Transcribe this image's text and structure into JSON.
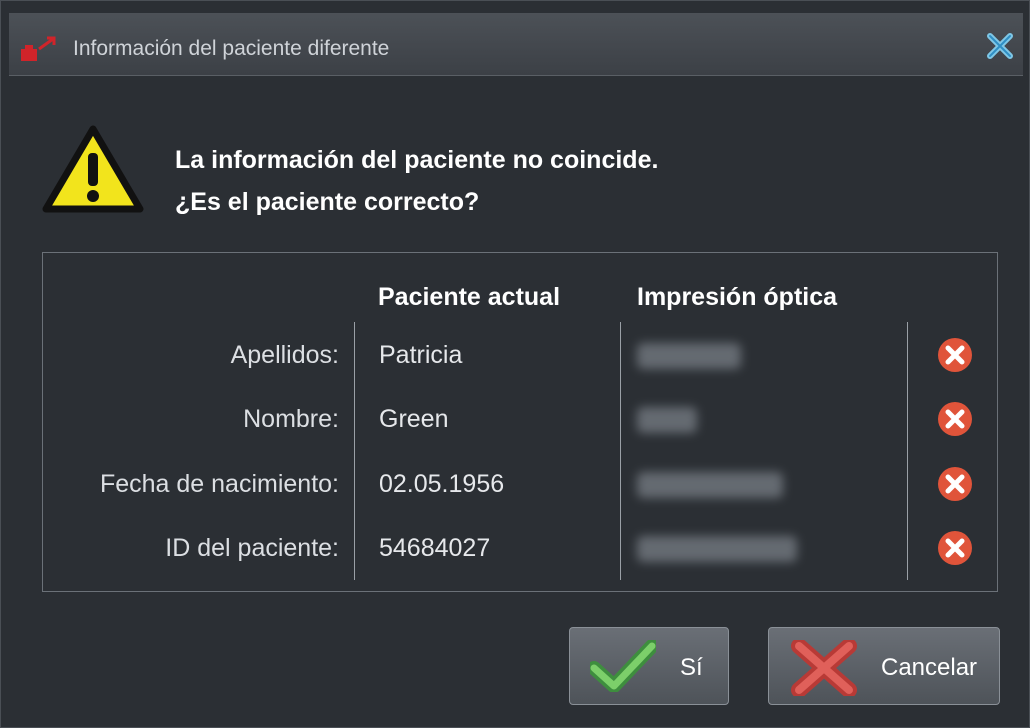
{
  "window": {
    "title": "Información del paciente diferente"
  },
  "message": {
    "line1": "La información del paciente no coincide.",
    "line2": "¿Es el paciente correcto?"
  },
  "table": {
    "headers": {
      "current": "Paciente actual",
      "optical": "Impresión óptica"
    },
    "rows": [
      {
        "label": "Apellidos:",
        "current": "Patricia",
        "optical_blurred": true,
        "status": "mismatch"
      },
      {
        "label": "Nombre:",
        "current": "Green",
        "optical_blurred": true,
        "status": "mismatch"
      },
      {
        "label": "Fecha de nacimiento:",
        "current": "02.05.1956",
        "optical_blurred": true,
        "status": "mismatch"
      },
      {
        "label": "ID del paciente:",
        "current": "54684027",
        "optical_blurred": true,
        "status": "mismatch"
      }
    ]
  },
  "buttons": {
    "yes_label": "Sí",
    "cancel_label": "Cancelar"
  },
  "colors": {
    "background": "#2b2f34",
    "warning_yellow": "#f2e41c",
    "mismatch_red": "#e0543a",
    "check_green": "#5cb85c"
  }
}
